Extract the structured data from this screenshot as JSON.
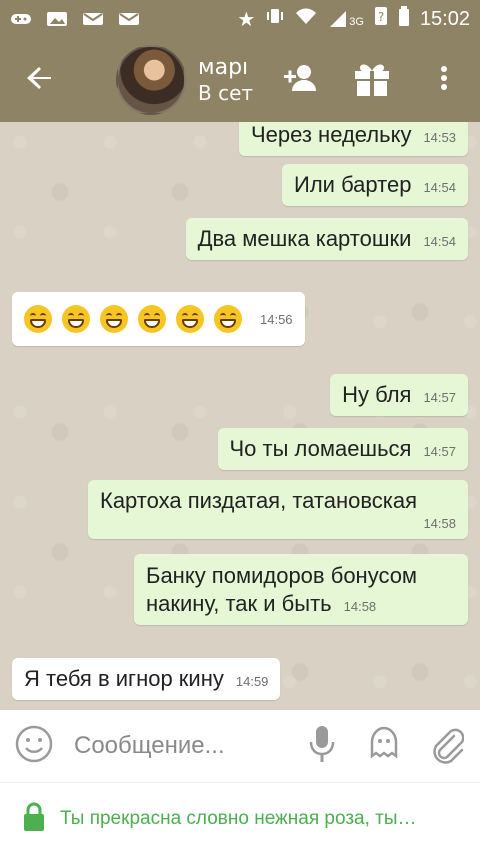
{
  "status_bar": {
    "time": "15:02",
    "network": "3G",
    "left_icons": [
      "gamepad-icon",
      "image-icon",
      "mail-icon",
      "mail-icon"
    ],
    "right_icons": [
      "star-icon",
      "vibrate-icon",
      "wifi-icon",
      "signal-icon",
      "unknown-icon",
      "battery-icon"
    ]
  },
  "header": {
    "title": "марı",
    "subtitle": "В сет"
  },
  "messages": [
    {
      "text": "Через недельку",
      "time": "14:53",
      "dir": "out"
    },
    {
      "text": "Или бартер",
      "time": "14:54",
      "dir": "out"
    },
    {
      "text": "Два мешка картошки",
      "time": "14:54",
      "dir": "out"
    },
    {
      "text": "",
      "time": "14:56",
      "dir": "in",
      "emoji_count": 6
    },
    {
      "text": "Ну бля",
      "time": "14:57",
      "dir": "out"
    },
    {
      "text": "Чо ты ломаешься",
      "time": "14:57",
      "dir": "out"
    },
    {
      "text": "Картоха пиздатая, татановская",
      "time": "14:58",
      "dir": "out"
    },
    {
      "text": "Банку помидоров бонусом накину, так и быть",
      "time": "14:58",
      "dir": "out"
    },
    {
      "text": "Я тебя в игнор кину",
      "time": "14:59",
      "dir": "in"
    }
  ],
  "composer": {
    "placeholder": "Сообщение..."
  },
  "hint": {
    "text": "Ты прекрасна словно нежная роза, ты…"
  },
  "colors": {
    "header_bg": "#8f8365",
    "outgoing_bg": "#e6f7d6",
    "incoming_bg": "#ffffff",
    "hint_green": "#4caf50"
  }
}
